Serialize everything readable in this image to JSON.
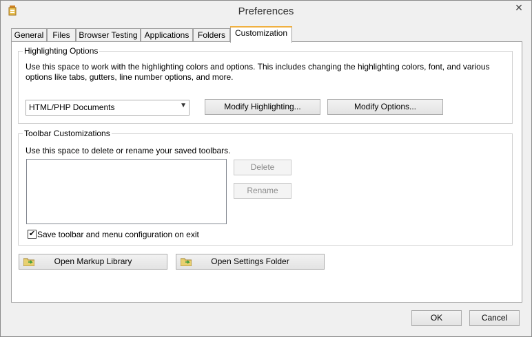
{
  "window": {
    "title": "Preferences",
    "close": "✕"
  },
  "tabs": [
    {
      "label": "General"
    },
    {
      "label": "Files"
    },
    {
      "label": "Browser Testing"
    },
    {
      "label": "Applications"
    },
    {
      "label": "Folders"
    },
    {
      "label": "Customization"
    }
  ],
  "highlighting": {
    "title": "Highlighting Options",
    "description": "Use this space to work with the highlighting colors and options. This includes changing the highlighting colors, font, and various options like tabs, gutters, line number options, and more.",
    "document_type": "HTML/PHP Documents",
    "modify_highlighting": "Modify Highlighting...",
    "modify_options": "Modify Options..."
  },
  "toolbar": {
    "title": "Toolbar Customizations",
    "description": "Use this space to delete or rename your saved toolbars.",
    "delete": "Delete",
    "rename": "Rename",
    "save_config_label": "Save toolbar and menu configuration on exit",
    "save_config_checked": "✔"
  },
  "actions": {
    "open_markup_library": "Open Markup Library",
    "open_settings_folder": "Open Settings Folder"
  },
  "footer": {
    "ok": "OK",
    "cancel": "Cancel"
  },
  "colors": {
    "active_tab_accent": "#f0b040",
    "window_bg": "#f0f0f0"
  }
}
